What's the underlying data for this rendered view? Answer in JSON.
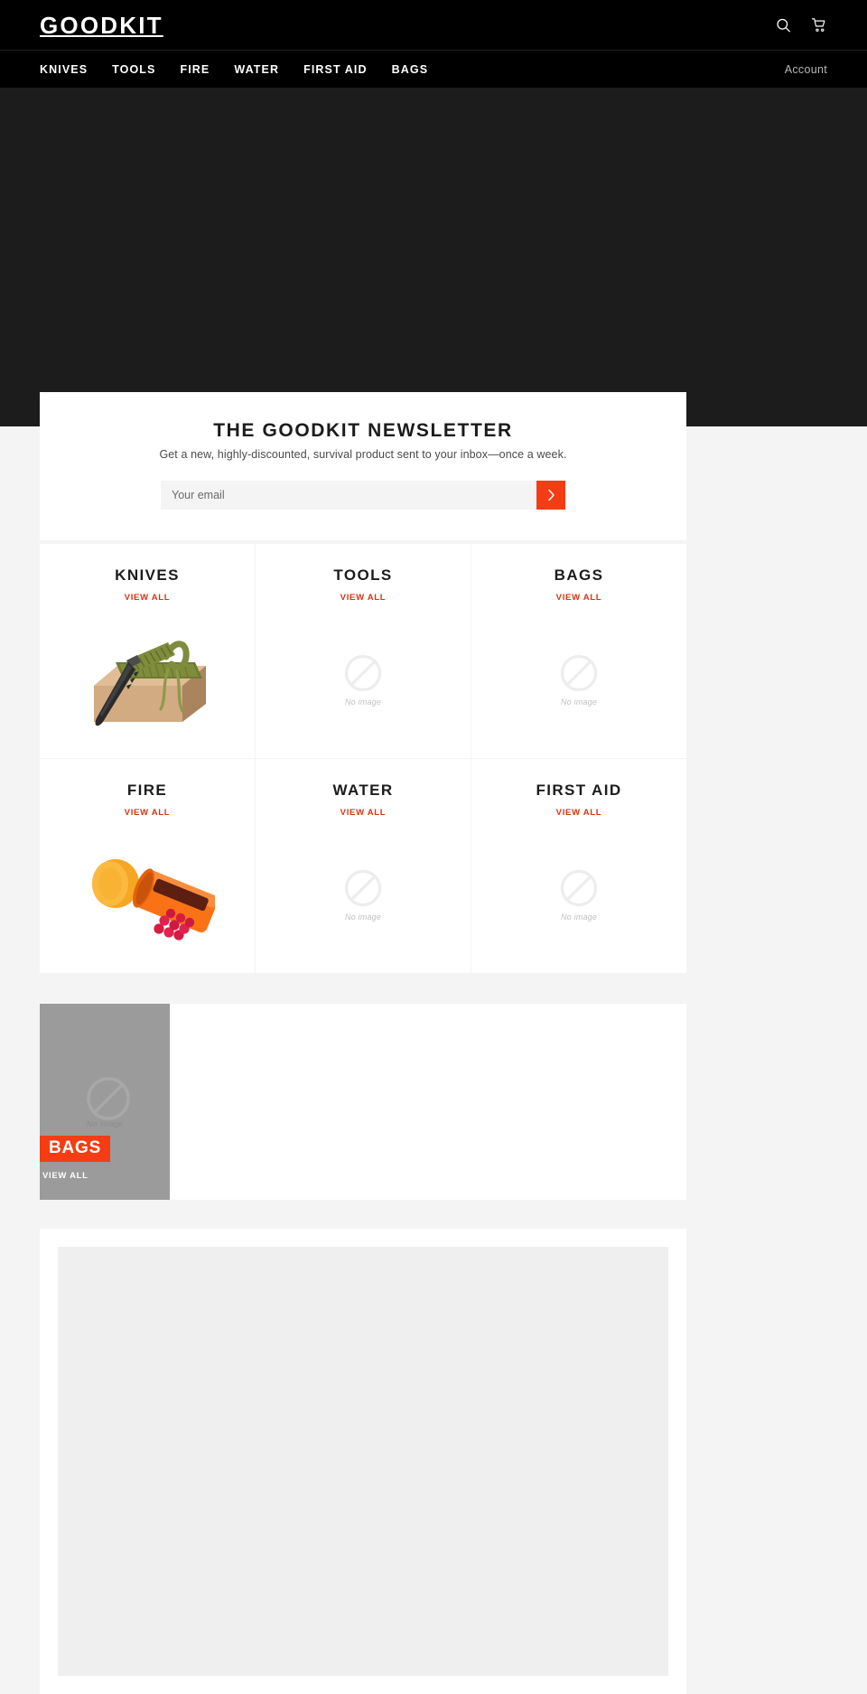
{
  "site": {
    "brand": "GOODKIT",
    "accent_color": "#f43d15",
    "link_color": "#d8340f",
    "header_bg": "#000000",
    "hero_bg": "#1c1c1c",
    "page_bg": "#f4f4f4"
  },
  "header": {
    "logo": "GOODKIT",
    "search_icon": "search-icon",
    "cart_icon": "cart-icon"
  },
  "nav": {
    "items": [
      {
        "label": "KNIVES"
      },
      {
        "label": "TOOLS"
      },
      {
        "label": "FIRE"
      },
      {
        "label": "WATER"
      },
      {
        "label": "FIRST AID"
      },
      {
        "label": "BAGS"
      }
    ],
    "account_label": "Account"
  },
  "newsletter": {
    "title": "THE GOODKIT NEWSLETTER",
    "subtitle": "Get a new, highly-discounted, survival product sent to your inbox—once a week.",
    "email_placeholder": "Your email",
    "email_value": "",
    "submit_icon": "chevron-right-icon"
  },
  "categories": [
    {
      "title": "KNIVES",
      "view_all": "VIEW ALL",
      "image": "survival-knife-paracord-on-box",
      "has_image": true
    },
    {
      "title": "TOOLS",
      "view_all": "VIEW ALL",
      "image": "no-image-placeholder",
      "has_image": false,
      "no_image_caption": "No image"
    },
    {
      "title": "BAGS",
      "view_all": "VIEW ALL",
      "image": "no-image-placeholder",
      "has_image": false,
      "no_image_caption": "No image"
    },
    {
      "title": "FIRE",
      "view_all": "VIEW ALL",
      "image": "orange-waterproof-match-container",
      "has_image": true
    },
    {
      "title": "WATER",
      "view_all": "VIEW ALL",
      "image": "no-image-placeholder",
      "has_image": false,
      "no_image_caption": "No image"
    },
    {
      "title": "FIRST AID",
      "view_all": "VIEW ALL",
      "image": "no-image-placeholder",
      "has_image": false,
      "no_image_caption": "No image"
    }
  ],
  "promo": {
    "label": "BAGS",
    "view_all": "VIEW ALL",
    "no_image_caption": "No image",
    "image": "no-image-placeholder"
  }
}
